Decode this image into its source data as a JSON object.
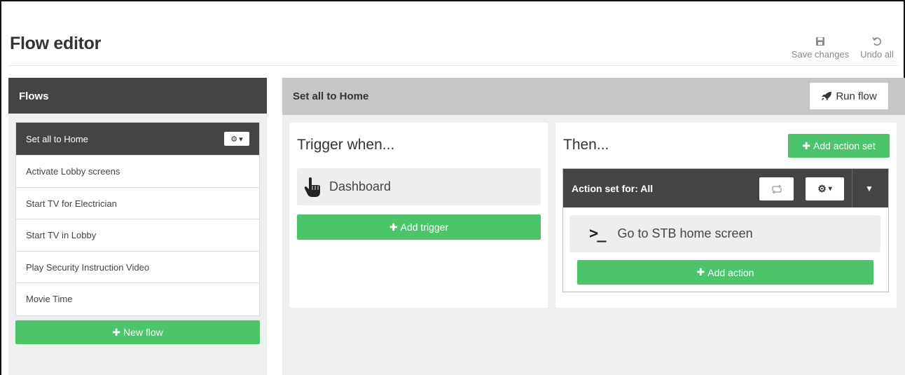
{
  "header": {
    "title": "Flow editor",
    "save_label": "Save changes",
    "undo_label": "Undo all"
  },
  "flows_panel": {
    "title": "Flows",
    "items": [
      {
        "label": "Set all to Home",
        "active": true
      },
      {
        "label": "Activate Lobby screens"
      },
      {
        "label": "Start TV for Electrician"
      },
      {
        "label": "Start TV in Lobby"
      },
      {
        "label": "Play Security Instruction Video"
      },
      {
        "label": "Movie Time"
      }
    ],
    "new_flow_label": "New flow"
  },
  "flow": {
    "name": "Set all to Home",
    "run_label": "Run flow",
    "trigger": {
      "title": "Trigger when...",
      "item_label": "Dashboard",
      "add_label": "Add trigger"
    },
    "then": {
      "title": "Then...",
      "add_action_set_label": "Add action set",
      "action_set": {
        "title": "Action set for: All",
        "action_label": "Go to STB home screen",
        "add_action_label": "Add action"
      }
    }
  },
  "icons": {
    "save": "floppy-disk-icon",
    "undo": "undo-icon",
    "gear": "gear-icon",
    "rocket": "rocket-icon",
    "hand": "pointing-hand-icon",
    "terminal": "terminal-prompt-icon",
    "repeat": "repeat-icon",
    "caret": "caret-down-icon"
  },
  "colors": {
    "green": "#4cc46a",
    "dark": "#444444",
    "header_gray": "#c6c6c6",
    "panel_bg": "#efefef"
  }
}
